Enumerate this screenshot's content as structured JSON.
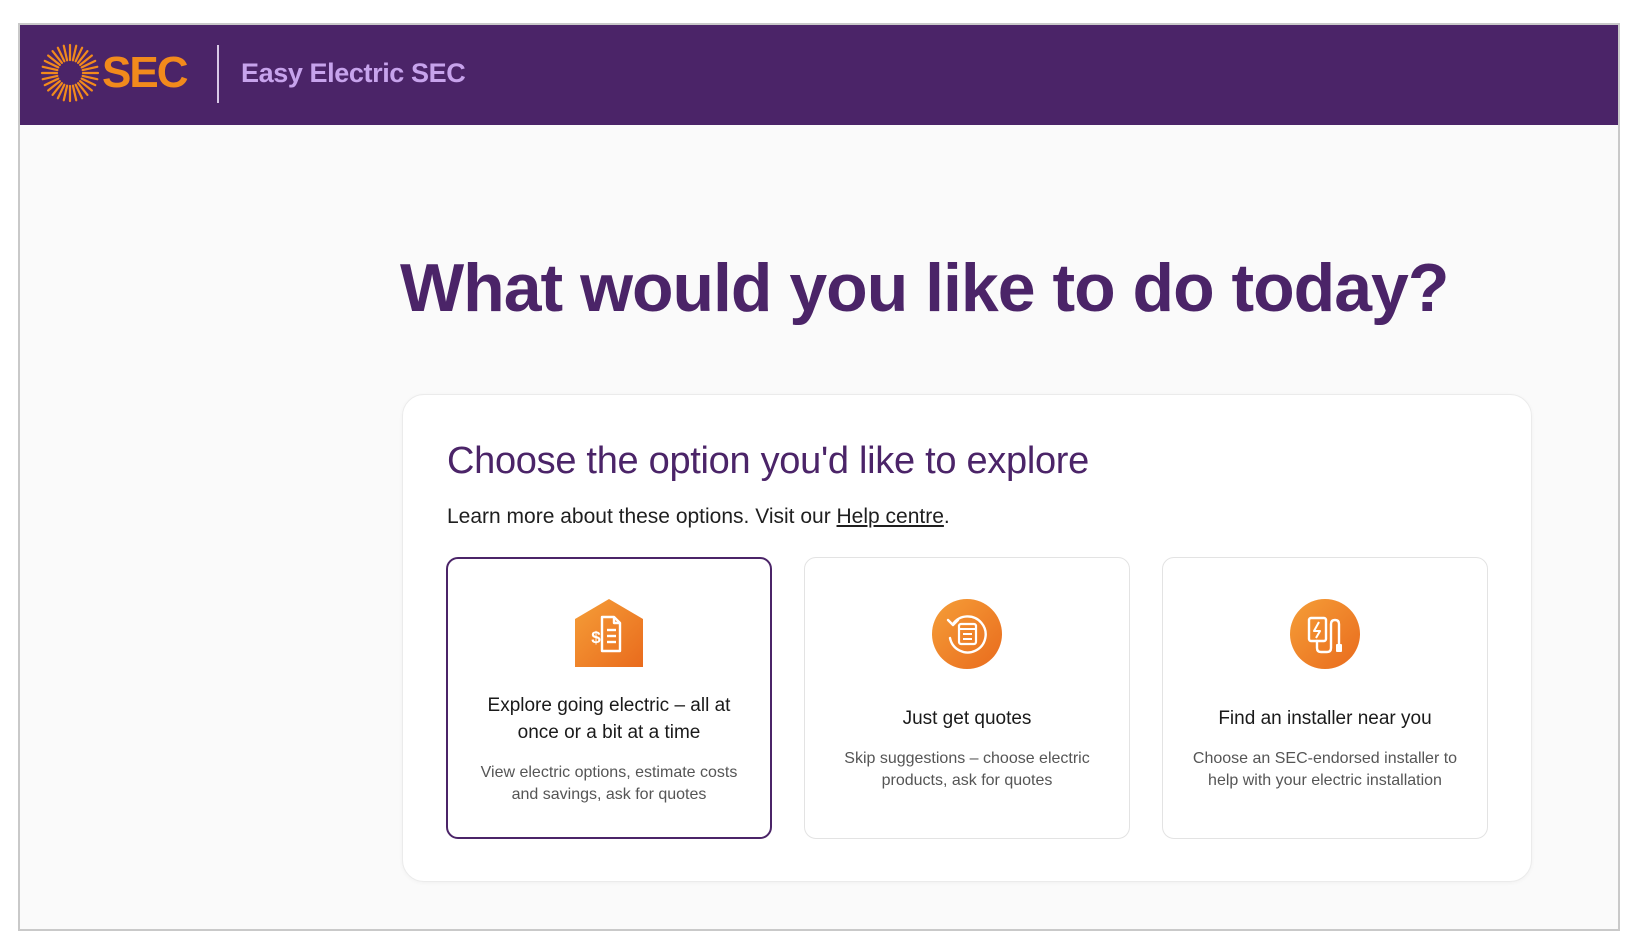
{
  "header": {
    "logo_text": "SEC",
    "app_name": "Easy Electric SEC"
  },
  "main": {
    "heading": "What would you like to do today?",
    "panel": {
      "title": "Choose the option you'd like to explore",
      "intro_prefix": "Learn more about these options. Visit our ",
      "help_link": "Help centre",
      "intro_suffix": ".",
      "options": [
        {
          "title": "Explore going electric – all at once or a bit at a time",
          "description": "View electric options, estimate costs and savings, ask for quotes",
          "icon": "house-bill-icon",
          "selected": true
        },
        {
          "title": "Just get quotes",
          "description": "Skip suggestions – choose electric products, ask for quotes",
          "icon": "quote-refresh-icon",
          "selected": false
        },
        {
          "title": "Find an installer near you",
          "description": "Choose an SEC-endorsed installer to help with your electric installation",
          "icon": "installer-plug-icon",
          "selected": false
        }
      ]
    }
  },
  "colors": {
    "brand_purple": "#4b2468",
    "brand_orange": "#f28a1c",
    "app_name_lavender": "#c7a3ec"
  }
}
